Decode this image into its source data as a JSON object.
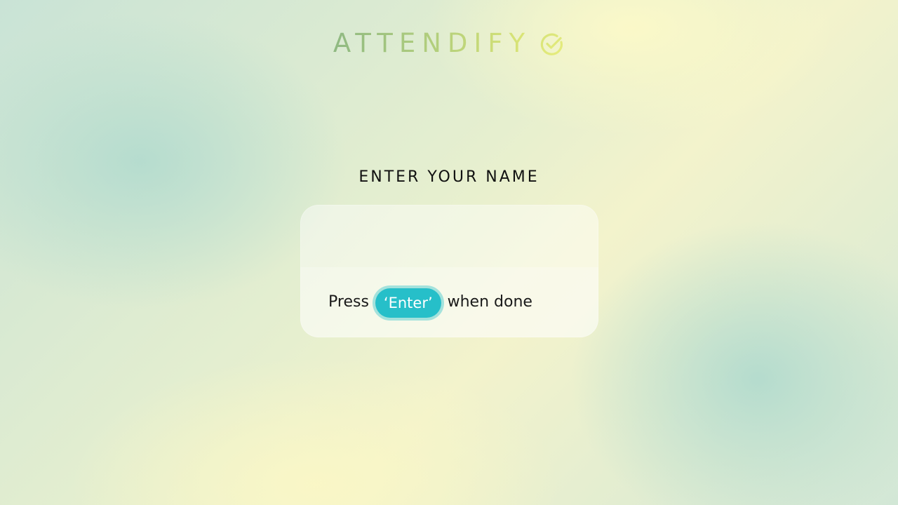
{
  "app": {
    "brand_name": "ATTENDIFY",
    "brand_icon": "check-circle-icon",
    "brand_gradient": [
      "#8fb982",
      "#dde675"
    ]
  },
  "form": {
    "title": "ENTER YOUR NAME",
    "name_value": "",
    "name_placeholder": "",
    "hint_prefix": "Press",
    "hint_key": "‘Enter’",
    "hint_suffix": "when done",
    "accent_color": "#26bfc9"
  }
}
